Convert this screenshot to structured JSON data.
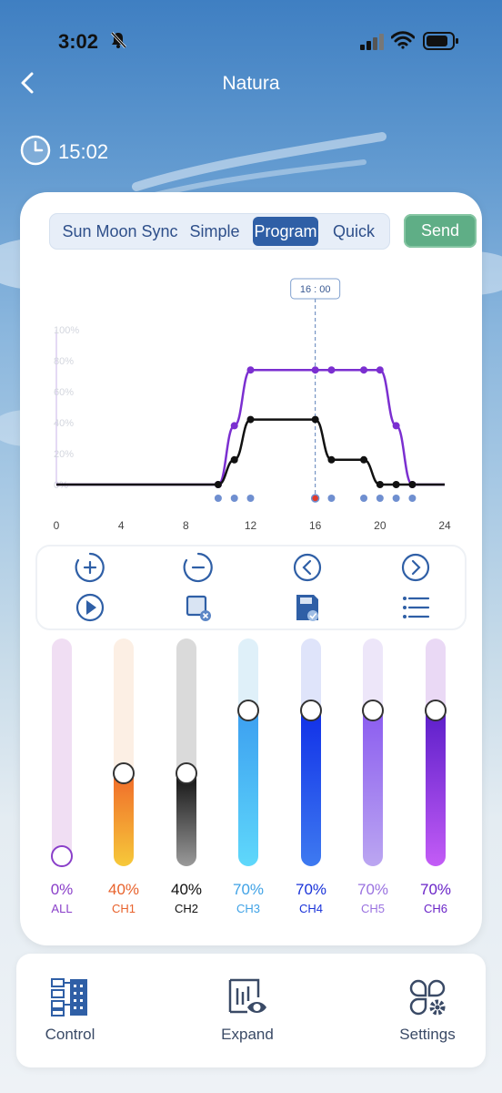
{
  "status": {
    "time": "3:02"
  },
  "nav": {
    "title": "Natura"
  },
  "clock": {
    "time": "15:02"
  },
  "tabs": [
    {
      "label": "Sun Moon Sync",
      "active": false
    },
    {
      "label": "Simple",
      "active": false
    },
    {
      "label": "Program",
      "active": true
    },
    {
      "label": "Quick",
      "active": false
    }
  ],
  "send_label": "Send",
  "chart_data": {
    "type": "line",
    "cursor_label": "16 : 00",
    "cursor_x": 16,
    "x_ticks": [
      "0",
      "4",
      "8",
      "12",
      "16",
      "20",
      "24"
    ],
    "y_ticks": [
      "0%",
      "20%",
      "40%",
      "60%",
      "80%",
      "100%"
    ],
    "xlim": [
      0,
      24
    ],
    "ylim": [
      0,
      100
    ],
    "series": [
      {
        "color": "#7b2fd0",
        "x": [
          0,
          10,
          11,
          12,
          16,
          17,
          19,
          20,
          21,
          22,
          24
        ],
        "y": [
          0,
          0,
          38,
          74,
          74,
          74,
          74,
          74,
          38,
          0,
          0
        ]
      },
      {
        "color": "#111111",
        "x": [
          0,
          10,
          11,
          12,
          16,
          17,
          19,
          20,
          21,
          22,
          24
        ],
        "y": [
          0,
          0,
          16,
          42,
          42,
          16,
          16,
          0,
          0,
          0,
          0
        ]
      }
    ],
    "markers": [
      10,
      11,
      12,
      16,
      17,
      19,
      20,
      21,
      22
    ],
    "active_marker": 16
  },
  "toolbar": [
    {
      "name": "add-point-icon"
    },
    {
      "name": "remove-point-icon"
    },
    {
      "name": "previous-point-icon"
    },
    {
      "name": "next-point-icon"
    },
    {
      "name": "play-preview-icon"
    },
    {
      "name": "clear-icon"
    },
    {
      "name": "save-icon"
    },
    {
      "name": "list-icon"
    }
  ],
  "channels": [
    {
      "label": "ALL",
      "value": "0%",
      "level": 0,
      "color": "#8a3fc9",
      "track": "#f0def3",
      "fill_top": "#e8d8f3",
      "fill_bottom": "#e8d8f3"
    },
    {
      "label": "CH1",
      "value": "40%",
      "level": 40,
      "color": "#e8622c",
      "track": "#fcefe4",
      "fill_top": "#f06a2a",
      "fill_bottom": "#f6c93a"
    },
    {
      "label": "CH2",
      "value": "40%",
      "level": 40,
      "color": "#111111",
      "track": "#dadada",
      "fill_top": "#111111",
      "fill_bottom": "#9a9a9a"
    },
    {
      "label": "CH3",
      "value": "70%",
      "level": 70,
      "color": "#3fa2e6",
      "track": "#dff0f9",
      "fill_top": "#3c9ff0",
      "fill_bottom": "#5fd8fb"
    },
    {
      "label": "CH4",
      "value": "70%",
      "level": 70,
      "color": "#1a33d9",
      "track": "#dfe4fa",
      "fill_top": "#1130e8",
      "fill_bottom": "#3e7af0"
    },
    {
      "label": "CH5",
      "value": "70%",
      "level": 70,
      "color": "#9a72e0",
      "track": "#ede6f9",
      "fill_top": "#8b5cf0",
      "fill_bottom": "#bba6f1"
    },
    {
      "label": "CH6",
      "value": "70%",
      "level": 70,
      "color": "#6a24c8",
      "track": "#ead9f5",
      "fill_top": "#5b1ec9",
      "fill_bottom": "#c35cf6"
    }
  ],
  "bottom_nav": [
    {
      "label": "Control",
      "icon": "control-icon"
    },
    {
      "label": "Expand",
      "icon": "expand-icon"
    },
    {
      "label": "Settings",
      "icon": "settings-icon"
    }
  ]
}
